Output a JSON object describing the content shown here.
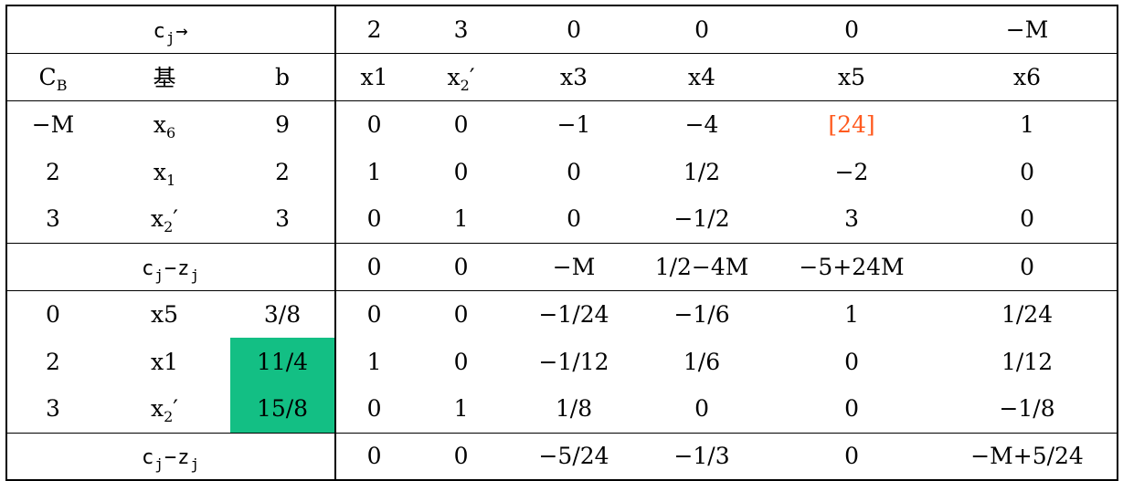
{
  "tableau": {
    "cj_label": "c",
    "cj_sub": "j",
    "cj_arrow": "→",
    "cj_values": [
      "2",
      "3",
      "0",
      "0",
      "0",
      "−M"
    ],
    "header": {
      "cb": "C",
      "cb_sub": "B",
      "basis": "基",
      "b": "b",
      "vars": [
        "x1",
        "x2′",
        "x3",
        "x4",
        "x5",
        "x6"
      ]
    },
    "block1": [
      {
        "cb": "−M",
        "basis": "x6",
        "b": "9",
        "vals": [
          "0",
          "0",
          "−1",
          "−4",
          "[24]",
          "1"
        ]
      },
      {
        "cb": "2",
        "basis": "x1",
        "b": "2",
        "vals": [
          "1",
          "0",
          "0",
          "1/2",
          "−2",
          "0"
        ]
      },
      {
        "cb": "3",
        "basis": "x2′",
        "b": "3",
        "vals": [
          "0",
          "1",
          "0",
          "−1/2",
          "3",
          "0"
        ]
      }
    ],
    "czj1_label": "cj−zj",
    "czj1": [
      "0",
      "0",
      "−M",
      "1/2−4M",
      "−5+24M",
      "0"
    ],
    "block2": [
      {
        "cb": "0",
        "basis": "x5",
        "b": "3/8",
        "vals": [
          "0",
          "0",
          "−1/24",
          "−1/6",
          "1",
          "1/24"
        ]
      },
      {
        "cb": "2",
        "basis": "x1",
        "b": "11/4",
        "vals": [
          "1",
          "0",
          "−1/12",
          "1/6",
          "0",
          "1/12"
        ]
      },
      {
        "cb": "3",
        "basis": "x2′",
        "b": "15/8",
        "vals": [
          "0",
          "1",
          "1/8",
          "0",
          "0",
          "−1/8"
        ]
      }
    ],
    "czj2_label": "cj−zj",
    "czj2": [
      "0",
      "0",
      "−5/24",
      "−1/3",
      "0",
      "−M+5/24"
    ],
    "colors": {
      "border": "#000000",
      "pivot": "#ff5a1f",
      "highlight": "#13bf84"
    }
  }
}
